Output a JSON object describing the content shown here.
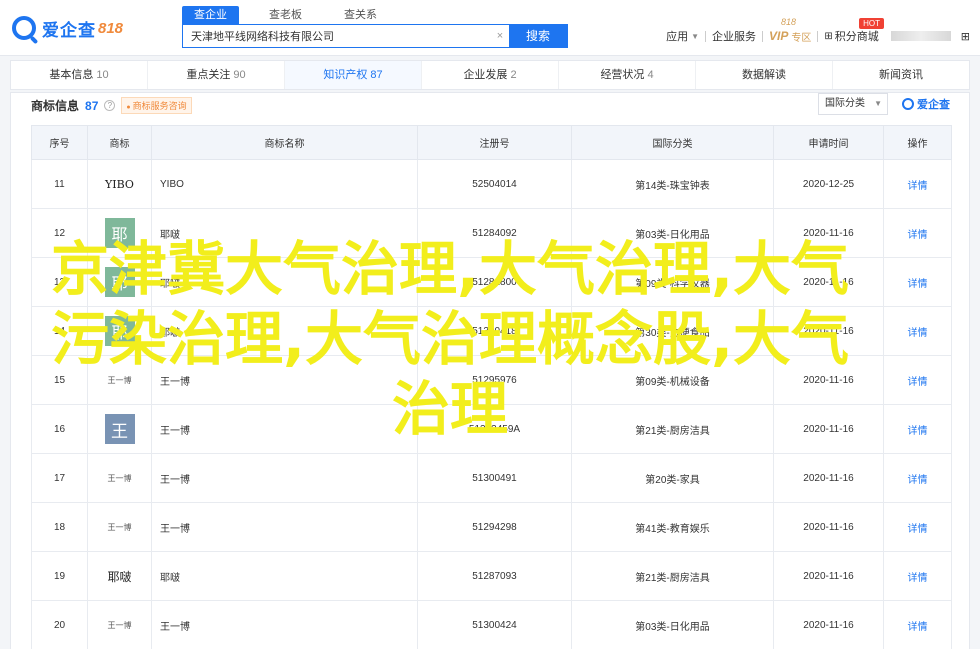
{
  "header": {
    "brand": "爱企查",
    "brand_num": "818",
    "search_tabs": [
      "查企业",
      "查老板",
      "查关系"
    ],
    "search_value": "天津地平线网络科技有限公司",
    "clear_icon": "×",
    "search_btn": "搜索",
    "links": {
      "app": "应用",
      "enterprise": "企业服务",
      "vip": "VIP",
      "vip_sub": "专区",
      "vip_tag": "818",
      "hot": "HOT",
      "points": "积分商城"
    }
  },
  "nav": [
    {
      "label": "基本信息",
      "count": "10"
    },
    {
      "label": "重点关注",
      "count": "90"
    },
    {
      "label": "知识产权",
      "count": "87",
      "active": true
    },
    {
      "label": "企业发展",
      "count": "2"
    },
    {
      "label": "经营状况",
      "count": "4"
    },
    {
      "label": "数据解读",
      "count": ""
    },
    {
      "label": "新闻资讯",
      "count": ""
    }
  ],
  "section": {
    "title": "商标信息",
    "count": "87",
    "help": "?",
    "service_tag": "商标服务咨询",
    "filter": "国际分类",
    "brand": "爱企查"
  },
  "table": {
    "headers": [
      "序号",
      "商标",
      "商标名称",
      "注册号",
      "国际分类",
      "申请时间",
      "操作"
    ],
    "rows": [
      {
        "idx": "11",
        "mark": "YIBO",
        "mark_style": "text",
        "name": "YIBO",
        "reg": "52504014",
        "cls": "第14类-珠宝钟表",
        "date": "2020-12-25",
        "op": "详情"
      },
      {
        "idx": "12",
        "mark": "耶",
        "mark_style": "green",
        "name": "耶啵",
        "reg": "51284092",
        "cls": "第03类-日化用品",
        "date": "2020-11-16",
        "op": "详情"
      },
      {
        "idx": "13",
        "mark": "耶",
        "mark_style": "green",
        "name": "耶啵",
        "reg": "51281800",
        "cls": "第09类-科学仪器",
        "date": "2020-11-16",
        "op": "详情"
      },
      {
        "idx": "14",
        "mark": "耶",
        "mark_style": "green",
        "name": "耶啵",
        "reg": "51300418",
        "cls": "第30类-方便食品",
        "date": "2020-11-16",
        "op": "详情"
      },
      {
        "idx": "15",
        "mark": "王一博",
        "mark_style": "small",
        "name": "王一博",
        "reg": "51295976",
        "cls": "第09类-机械设备",
        "date": "2020-11-16",
        "op": "详情"
      },
      {
        "idx": "16",
        "mark": "王",
        "mark_style": "blue",
        "name": "王一博",
        "reg": "51303459A",
        "cls": "第21类-厨房洁具",
        "date": "2020-11-16",
        "op": "详情"
      },
      {
        "idx": "17",
        "mark": "王一博",
        "mark_style": "small",
        "name": "王一博",
        "reg": "51300491",
        "cls": "第20类-家具",
        "date": "2020-11-16",
        "op": "详情"
      },
      {
        "idx": "18",
        "mark": "王一博",
        "mark_style": "small",
        "name": "王一博",
        "reg": "51294298",
        "cls": "第41类-教育娱乐",
        "date": "2020-11-16",
        "op": "详情"
      },
      {
        "idx": "19",
        "mark": "耶啵",
        "mark_style": "serif",
        "name": "耶啵",
        "reg": "51287093",
        "cls": "第21类-厨房洁具",
        "date": "2020-11-16",
        "op": "详情"
      },
      {
        "idx": "20",
        "mark": "王一博",
        "mark_style": "small",
        "name": "王一博",
        "reg": "51300424",
        "cls": "第03类-日化用品",
        "date": "2020-11-16",
        "op": "详情"
      }
    ]
  },
  "overlay": {
    "line1": "京津冀大气治理,大气治理,大气",
    "line2": "污染治理,大气治理概念股,大气",
    "line3": "治理"
  },
  "colors": {
    "accent": "#1e75f0",
    "overlay": "#f2ee1c",
    "orange": "#f08a3c"
  },
  "icons": {
    "search": "search-icon",
    "clear": "close-icon",
    "app": "grid-icon",
    "help": "help-icon",
    "dropdown": "chevron-down-icon"
  }
}
